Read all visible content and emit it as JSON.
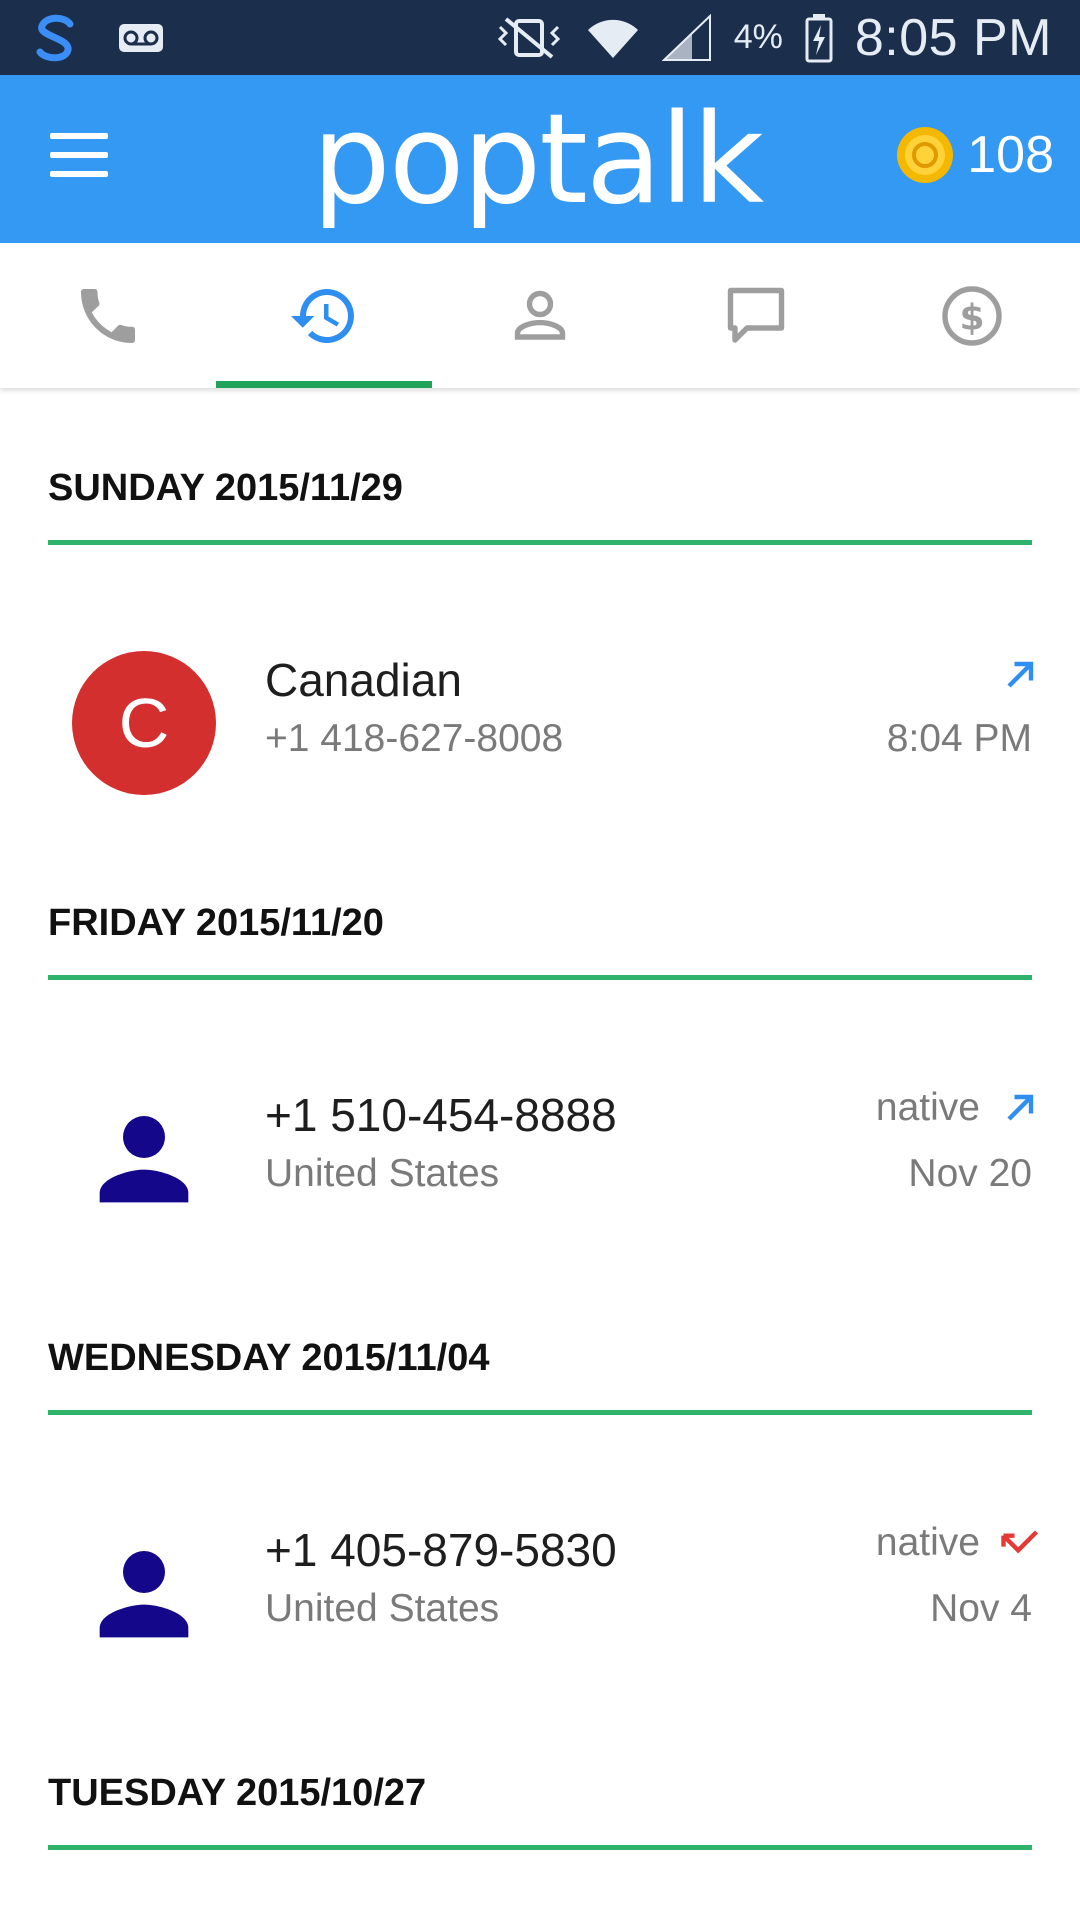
{
  "status_bar": {
    "battery_percent": "4%",
    "time": "8:05 PM"
  },
  "app_bar": {
    "logo": "poptalk",
    "coin_count": "108"
  },
  "tabs": [
    {
      "name": "phone-icon",
      "active": false
    },
    {
      "name": "history-icon",
      "active": true
    },
    {
      "name": "contacts-icon",
      "active": false
    },
    {
      "name": "messages-icon",
      "active": false
    },
    {
      "name": "credits-icon",
      "active": false
    }
  ],
  "sections": [
    {
      "header": "SUNDAY 2015/11/29",
      "calls": [
        {
          "avatar_letter": "C",
          "title": "Canadian",
          "subtitle": "+1 418-627-8008",
          "tag": "",
          "direction": "outgoing",
          "time": "8:04 PM"
        }
      ]
    },
    {
      "header": "FRIDAY 2015/11/20",
      "calls": [
        {
          "avatar_letter": "",
          "title": "+1 510-454-8888",
          "subtitle": "United States",
          "tag": "native",
          "direction": "outgoing",
          "time": "Nov 20"
        }
      ]
    },
    {
      "header": "WEDNESDAY 2015/11/04",
      "calls": [
        {
          "avatar_letter": "",
          "title": "+1 405-879-5830",
          "subtitle": "United States",
          "tag": "native",
          "direction": "missed",
          "time": "Nov 4"
        }
      ]
    },
    {
      "header": "TUESDAY 2015/10/27",
      "calls": []
    }
  ],
  "colors": {
    "status_bar": "#1b2e4c",
    "app_bar": "#3399f3",
    "accent_green": "#2fb36a",
    "avatar_red": "#d32f2f",
    "person_icon": "#14078a",
    "outgoing_arrow": "#2f8ff0",
    "missed_arrow": "#e53935"
  }
}
